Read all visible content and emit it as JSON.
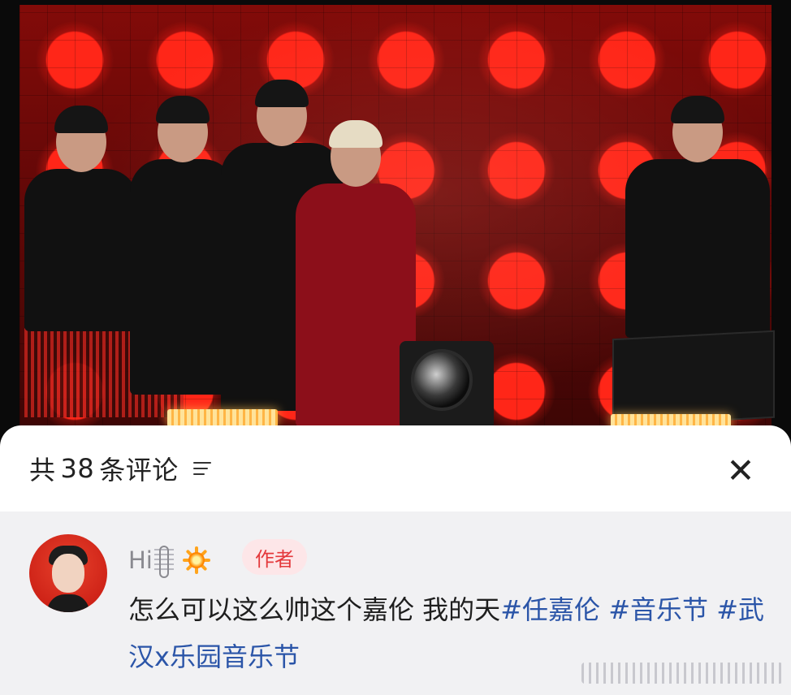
{
  "photo": {
    "description_icon": "concert-stage-photo"
  },
  "comments_sheet": {
    "title_prefix": "共",
    "count": "38",
    "title_suffix": "条评论",
    "sort_icon": "sort-lines-icon",
    "close_icon": "close-icon",
    "close_label": "✕"
  },
  "comment": {
    "username": "Hi",
    "username_icons": [
      "music-staff-icon",
      "sparkle-icon"
    ],
    "badge": "作者",
    "text": "怎么可以这么帅这个嘉伦 我的天",
    "tags": [
      "#任嘉伦",
      "#音乐节",
      "#武汉x乐园音乐节"
    ]
  },
  "colors": {
    "accent_tag": "#2b55a8",
    "badge_text": "#e4393c",
    "badge_bg": "#fde6e8",
    "comment_bg": "#f1f1f3"
  }
}
